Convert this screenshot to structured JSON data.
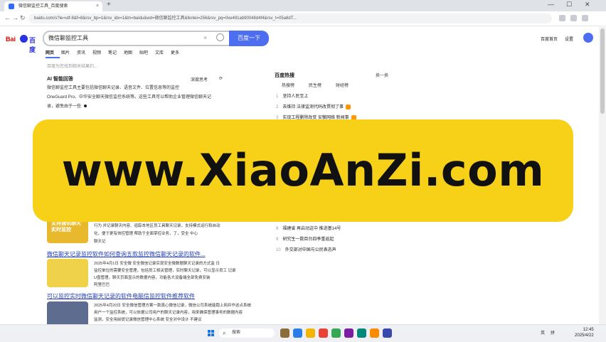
{
  "browser": {
    "tab_title": "微信聊监控工具_百度搜索",
    "url": "baidu.com/s?ie=utf-8&f=8&rsv_bp=1&rsv_idx=1&tn=baidu&wd=微信聊监控工具&fenlei=256&rsv_pq=0xe491ab90048d4f4&rsv_t=05a8dT...",
    "new_tab": "+",
    "close_tab": "×",
    "window_minimize": "—",
    "window_maximize": "☐",
    "window_close": "✕",
    "nav_back": "←",
    "nav_forward": "→",
    "nav_refresh": "↻"
  },
  "search": {
    "logo_left": "Bai",
    "logo_right": "百度",
    "query": "微信聊监控工具",
    "clear": "×",
    "button_label": "百度一下",
    "top_links": [
      "百度首页",
      "设置"
    ],
    "nav_tabs": [
      "网页",
      "图片",
      "资讯",
      "视频",
      "笔记",
      "地图",
      "贴吧",
      "文库",
      "更多"
    ],
    "result_count": "百度为您找到相关结果约..."
  },
  "ai_answer": {
    "title": "AI 智能回答",
    "options": [
      "深度思考",
      "⟳"
    ],
    "lines": [
      "微信聊监控工具主要包括微信聊天记录、语音文件、位置信息等的监控",
      "OneGuard Pro、中华安全聊天微信监控系统等。这些工具可以帮助企业管理微信聊天记",
      "录，避免由于一些"
    ]
  },
  "hot_search": {
    "title": "百度热搜",
    "refresh": "换一换",
    "tabs": [
      "热搜榜",
      "民生榜",
      "财经榜"
    ],
    "items": [
      {
        "rank": "1",
        "text": "坚持人民至上",
        "hot": false
      },
      {
        "rank": "2",
        "text": "去维持 法律监测代码改贯彻了事",
        "hot": true
      },
      {
        "rank": "3",
        "text": "实现工程删除改变 安徽网络 新闻事",
        "hot": true
      },
      {
        "rank": "8",
        "text": "福建省 再启动这中 推进基14号",
        "hot": false
      },
      {
        "rank": "9",
        "text": "研究生一数目台四季重返起",
        "hot": false
      },
      {
        "rank": "10",
        "text": "外交部对中国与公民表态声",
        "hot": false
      }
    ]
  },
  "results": [
    {
      "thumb_text": "支持通讯聊天 实时监控",
      "thumb_color": "#e8b82d",
      "lines": [
        "行为 并记录聊天内容、追踪本地区员工具聊天记录，支持模式运行和自动",
        "化，便于更有效控管理 帮助于全面掌控业务，了，受全 中心",
        "聊天记"
      ]
    },
    {
      "title": "微信聊天记录监控软件如何查询五款监控微信聊天记录的软件...",
      "thumb_text": "",
      "thumb_color": "#f0d24a",
      "lines": [
        "2025年4月1日 安全微  安全微信记录实现安全微数据聊天记录的方式监  日",
        "监控单位的需要安全管理，包括员工相关管理，实时聊天记录，可以显示员工  记录",
        "U盘管理，聊天页面显示的数据内容，功能各大设备端全部免费安装",
        "阿里巴巴"
      ]
    },
    {
      "title": "可以监控实时微信聊天记录的软件电脑信监控软件推荐软件",
      "thumb_text": "",
      "thumb_color": "#5e6c8f",
      "lines": [
        "2025年4月20日 安全微信管理方案一款真心微信记录，微信公司系统能跑上网并作这点系统",
        "用户一个监控系统，可以依据公司用户的聊天记录内容，用来确保管理事务的数据内容",
        "监测，安全用前提记录微信管理中心系统 安全对中设计 不建议"
      ]
    }
  ],
  "watermark": {
    "text": "www.XiaoAnZi.com",
    "color": "#f7d117"
  },
  "taskbar": {
    "search_label": "搜索",
    "tray_items": [
      "英",
      "拼"
    ],
    "time": "12:45",
    "date": "2025/4/22"
  },
  "colors": {
    "brand_blue": "#4e6ef2",
    "link_blue": "#2440b3",
    "baidu_red": "#e10601"
  }
}
